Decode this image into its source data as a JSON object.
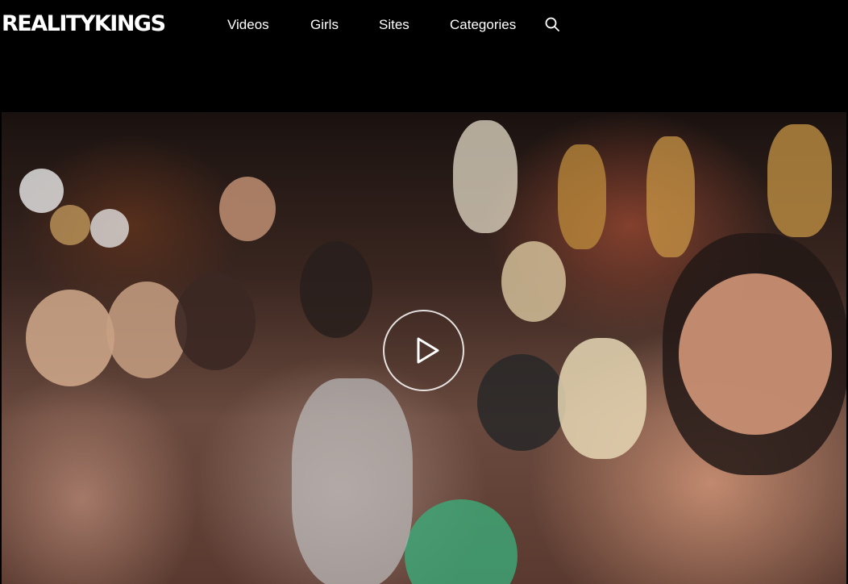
{
  "header": {
    "logo_text": "REALITYKINGS",
    "nav": [
      {
        "label": "Videos"
      },
      {
        "label": "Girls"
      },
      {
        "label": "Sites"
      },
      {
        "label": "Categories"
      }
    ],
    "search_icon": "search-icon"
  },
  "hero": {
    "media": "video-thumbnail",
    "play_icon": "play-icon"
  },
  "colors": {
    "background": "#000000",
    "text": "#ffffff"
  }
}
